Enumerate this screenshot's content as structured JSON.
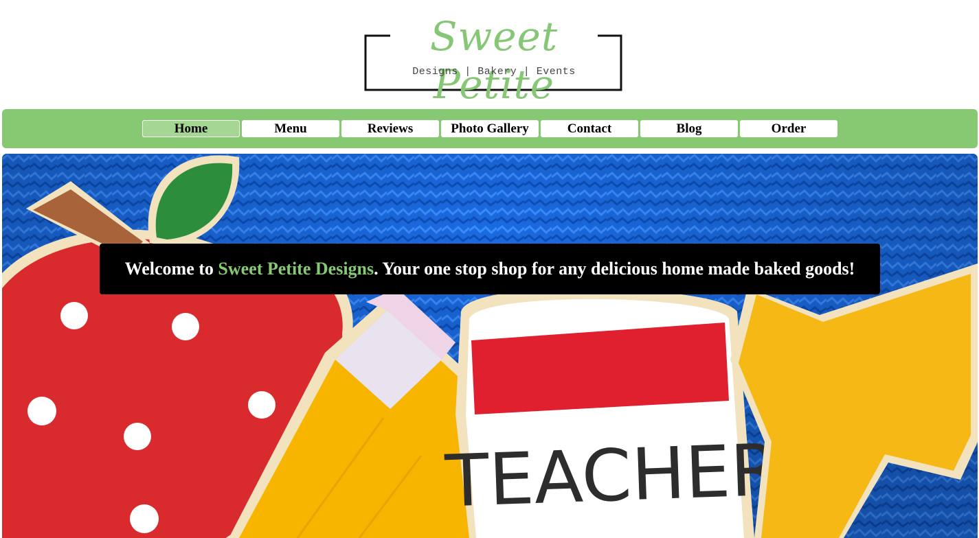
{
  "logo": {
    "title": "Sweet Petite",
    "tagline": "Designs | Bakery | Events",
    "accent_color": "#85c774"
  },
  "nav": {
    "background_color": "#87c873",
    "items": [
      {
        "label": "Home",
        "active": true
      },
      {
        "label": "Menu",
        "active": false
      },
      {
        "label": "Reviews",
        "active": false
      },
      {
        "label": "Photo Gallery",
        "active": false
      },
      {
        "label": "Contact",
        "active": false
      },
      {
        "label": "Blog",
        "active": false
      },
      {
        "label": "Order",
        "active": false
      }
    ]
  },
  "hero": {
    "image_subject": "decorated teacher cookies (apple, pencil, TEACHER cup, star) on blue shredded paper",
    "cookie_text": "TEACHER",
    "welcome": {
      "prefix": "Welcome to ",
      "brand": "Sweet Petite Designs",
      "suffix": ". Your one stop shop for any delicious home made baked goods!"
    }
  }
}
